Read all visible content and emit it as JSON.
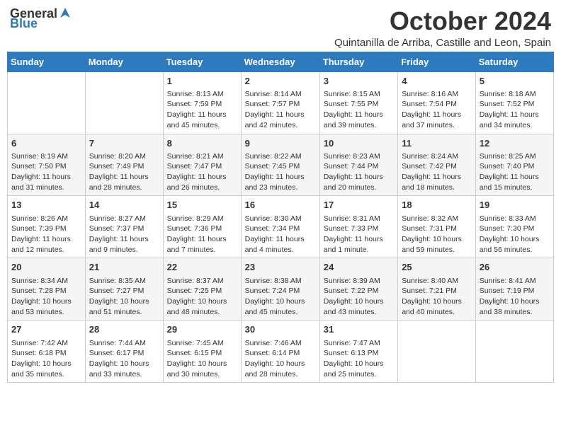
{
  "logo": {
    "general": "General",
    "blue": "Blue"
  },
  "title": "October 2024",
  "location": "Quintanilla de Arriba, Castille and Leon, Spain",
  "days_of_week": [
    "Sunday",
    "Monday",
    "Tuesday",
    "Wednesday",
    "Thursday",
    "Friday",
    "Saturday"
  ],
  "weeks": [
    [
      {
        "day": "",
        "info": ""
      },
      {
        "day": "",
        "info": ""
      },
      {
        "day": "1",
        "info": "Sunrise: 8:13 AM\nSunset: 7:59 PM\nDaylight: 11 hours and 45 minutes."
      },
      {
        "day": "2",
        "info": "Sunrise: 8:14 AM\nSunset: 7:57 PM\nDaylight: 11 hours and 42 minutes."
      },
      {
        "day": "3",
        "info": "Sunrise: 8:15 AM\nSunset: 7:55 PM\nDaylight: 11 hours and 39 minutes."
      },
      {
        "day": "4",
        "info": "Sunrise: 8:16 AM\nSunset: 7:54 PM\nDaylight: 11 hours and 37 minutes."
      },
      {
        "day": "5",
        "info": "Sunrise: 8:18 AM\nSunset: 7:52 PM\nDaylight: 11 hours and 34 minutes."
      }
    ],
    [
      {
        "day": "6",
        "info": "Sunrise: 8:19 AM\nSunset: 7:50 PM\nDaylight: 11 hours and 31 minutes."
      },
      {
        "day": "7",
        "info": "Sunrise: 8:20 AM\nSunset: 7:49 PM\nDaylight: 11 hours and 28 minutes."
      },
      {
        "day": "8",
        "info": "Sunrise: 8:21 AM\nSunset: 7:47 PM\nDaylight: 11 hours and 26 minutes."
      },
      {
        "day": "9",
        "info": "Sunrise: 8:22 AM\nSunset: 7:45 PM\nDaylight: 11 hours and 23 minutes."
      },
      {
        "day": "10",
        "info": "Sunrise: 8:23 AM\nSunset: 7:44 PM\nDaylight: 11 hours and 20 minutes."
      },
      {
        "day": "11",
        "info": "Sunrise: 8:24 AM\nSunset: 7:42 PM\nDaylight: 11 hours and 18 minutes."
      },
      {
        "day": "12",
        "info": "Sunrise: 8:25 AM\nSunset: 7:40 PM\nDaylight: 11 hours and 15 minutes."
      }
    ],
    [
      {
        "day": "13",
        "info": "Sunrise: 8:26 AM\nSunset: 7:39 PM\nDaylight: 11 hours and 12 minutes."
      },
      {
        "day": "14",
        "info": "Sunrise: 8:27 AM\nSunset: 7:37 PM\nDaylight: 11 hours and 9 minutes."
      },
      {
        "day": "15",
        "info": "Sunrise: 8:29 AM\nSunset: 7:36 PM\nDaylight: 11 hours and 7 minutes."
      },
      {
        "day": "16",
        "info": "Sunrise: 8:30 AM\nSunset: 7:34 PM\nDaylight: 11 hours and 4 minutes."
      },
      {
        "day": "17",
        "info": "Sunrise: 8:31 AM\nSunset: 7:33 PM\nDaylight: 11 hours and 1 minute."
      },
      {
        "day": "18",
        "info": "Sunrise: 8:32 AM\nSunset: 7:31 PM\nDaylight: 10 hours and 59 minutes."
      },
      {
        "day": "19",
        "info": "Sunrise: 8:33 AM\nSunset: 7:30 PM\nDaylight: 10 hours and 56 minutes."
      }
    ],
    [
      {
        "day": "20",
        "info": "Sunrise: 8:34 AM\nSunset: 7:28 PM\nDaylight: 10 hours and 53 minutes."
      },
      {
        "day": "21",
        "info": "Sunrise: 8:35 AM\nSunset: 7:27 PM\nDaylight: 10 hours and 51 minutes."
      },
      {
        "day": "22",
        "info": "Sunrise: 8:37 AM\nSunset: 7:25 PM\nDaylight: 10 hours and 48 minutes."
      },
      {
        "day": "23",
        "info": "Sunrise: 8:38 AM\nSunset: 7:24 PM\nDaylight: 10 hours and 45 minutes."
      },
      {
        "day": "24",
        "info": "Sunrise: 8:39 AM\nSunset: 7:22 PM\nDaylight: 10 hours and 43 minutes."
      },
      {
        "day": "25",
        "info": "Sunrise: 8:40 AM\nSunset: 7:21 PM\nDaylight: 10 hours and 40 minutes."
      },
      {
        "day": "26",
        "info": "Sunrise: 8:41 AM\nSunset: 7:19 PM\nDaylight: 10 hours and 38 minutes."
      }
    ],
    [
      {
        "day": "27",
        "info": "Sunrise: 7:42 AM\nSunset: 6:18 PM\nDaylight: 10 hours and 35 minutes."
      },
      {
        "day": "28",
        "info": "Sunrise: 7:44 AM\nSunset: 6:17 PM\nDaylight: 10 hours and 33 minutes."
      },
      {
        "day": "29",
        "info": "Sunrise: 7:45 AM\nSunset: 6:15 PM\nDaylight: 10 hours and 30 minutes."
      },
      {
        "day": "30",
        "info": "Sunrise: 7:46 AM\nSunset: 6:14 PM\nDaylight: 10 hours and 28 minutes."
      },
      {
        "day": "31",
        "info": "Sunrise: 7:47 AM\nSunset: 6:13 PM\nDaylight: 10 hours and 25 minutes."
      },
      {
        "day": "",
        "info": ""
      },
      {
        "day": "",
        "info": ""
      }
    ]
  ]
}
